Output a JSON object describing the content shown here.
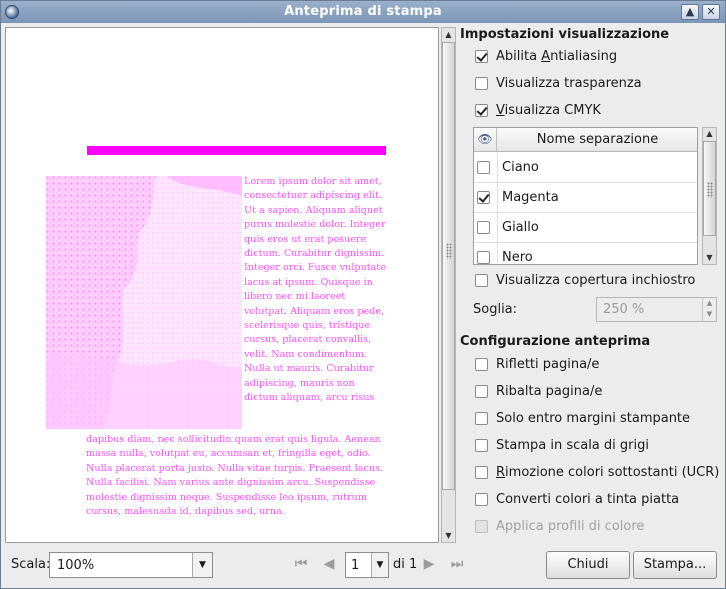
{
  "window": {
    "title": "Anteprima di stampa"
  },
  "preview": {
    "bar_color": "#ff00ff",
    "text_color": "#ff4dff",
    "column_text": "Lorem ipsum dolor sit amet, consectetuer adipiscing elit. Ut a sapien. Aliquam aliquet purus molestie dolor. Integer quis eros ut erat posuere dictum. Curabitur dignissim. Integer orci. Fusce vulputate lacus at ipsum. Quisque in libero nec mi laoreet volutpat. Aliquam eros pede, scelerisque quis, tristique cursus, placerat convallis, velit. Nam condimentum. Nulla ut mauris. Curabitur adipiscing, mauris non dictum aliquam, arcu risus",
    "wide_text_1": "dapibus diam, nec sollicitudin quam erat quis ligula. Aenean massa nulla, volutpat eu, accumsan et, fringilla eget, odio. Nulla placerat porta justo. Nulla vitae turpis. Praesent lacus.",
    "wide_text_2": "Nulla facilisi. Nam varius ante dignissim arcu. Suspendisse molestie dignissim neque. Suspendisse leo ipsum, rutrum cursus, malesuada id, dapibus sed, urna."
  },
  "settings": {
    "display_title": "Impostazioni visualizzazione",
    "antialiasing": {
      "pre": "Abilita ",
      "u": "A",
      "post": "ntialiasing",
      "checked": true
    },
    "transparency": {
      "label": "Visualizza trasparenza",
      "checked": false
    },
    "cmyk": {
      "pre": "",
      "u": "V",
      "post": "isualizza CMYK",
      "checked": true
    },
    "separations": {
      "header": "Nome separazione",
      "rows": [
        {
          "name": "Ciano",
          "checked": false
        },
        {
          "name": "Magenta",
          "checked": true
        },
        {
          "name": "Giallo",
          "checked": false
        },
        {
          "name": "Nero",
          "checked": false
        }
      ]
    },
    "ink_coverage": {
      "label": "Visualizza copertura inchiostro",
      "checked": false
    },
    "threshold": {
      "label": "Soglia:",
      "value": "250 %"
    },
    "preview_title": "Configurazione anteprima",
    "options": [
      {
        "label": "Rifletti pagina/e",
        "checked": false,
        "disabled": false
      },
      {
        "label": "Ribalta pagina/e",
        "checked": false,
        "disabled": false
      },
      {
        "label": "Solo entro margini stampante",
        "checked": false,
        "disabled": false
      },
      {
        "label": "Stampa in scala di grigi",
        "checked": false,
        "disabled": false
      },
      {
        "label": "Rimozione colori sottostanti (UCR)",
        "checked": false,
        "disabled": false,
        "underline": "R"
      },
      {
        "label": "Converti colori a tinta piatta",
        "checked": false,
        "disabled": false
      },
      {
        "label": "Applica profili di colore",
        "checked": false,
        "disabled": true
      }
    ]
  },
  "bottom": {
    "scale_label": "Scala:",
    "scale_value": "100%",
    "page_value": "1",
    "of_label": "di 1",
    "close_button": "Chiudi",
    "print_button": "Stampa..."
  }
}
